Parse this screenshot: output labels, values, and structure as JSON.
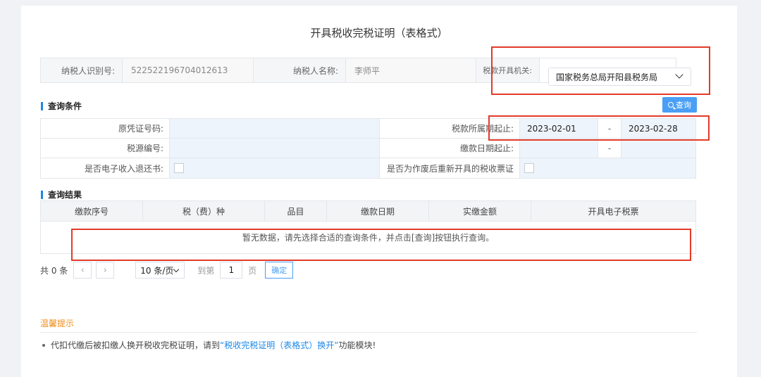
{
  "page": {
    "title": "开具税收完税证明（表格式）"
  },
  "taxpayer": {
    "id_label": "纳税人识别号:",
    "id_value": "522522196704012613",
    "name_label": "纳税人名称:",
    "name_value": "李师平",
    "authority_label": "税款开具机关:",
    "authority_value": "国家税务总局开阳县税务局"
  },
  "query": {
    "section_title": "查询条件",
    "button_label": "查询",
    "original_voucher_label": "原凭证号码:",
    "original_voucher_value": "",
    "tax_period_label": "税款所属期起止:",
    "tax_period_start": "2023-02-01",
    "tax_period_end": "2023-02-28",
    "range_sep": "-",
    "tax_source_label": "税源编号:",
    "payment_date_label": "缴款日期起止:",
    "e_refund_label": "是否电子收入退还书:",
    "reissue_label": "是否为作废后重新开具的税收票证"
  },
  "results": {
    "section_title": "查询结果",
    "columns": [
      "缴款序号",
      "税（费）种",
      "品目",
      "缴款日期",
      "实缴金额",
      "开具电子税票"
    ],
    "empty_message": "暂无数据，请先选择合适的查询条件，并点击[查询]按钮执行查询。"
  },
  "pager": {
    "total": "共 0 条",
    "prev": "‹",
    "next": "›",
    "page_size": "10 条/页",
    "goto_label": "到第",
    "page_value": "1",
    "page_unit": "页",
    "confirm": "确定"
  },
  "tips": {
    "title": "温馨提示",
    "text_before": "代扣代缴后被扣缴人换开税收完税证明，请到",
    "link": "“税收完税证明（表格式）换开”",
    "text_after": "功能模块!"
  },
  "colors": {
    "accent": "#1e88e5",
    "button": "#4a9ff5",
    "tips": "#f08c1a",
    "annotation": "#e23a2a"
  }
}
